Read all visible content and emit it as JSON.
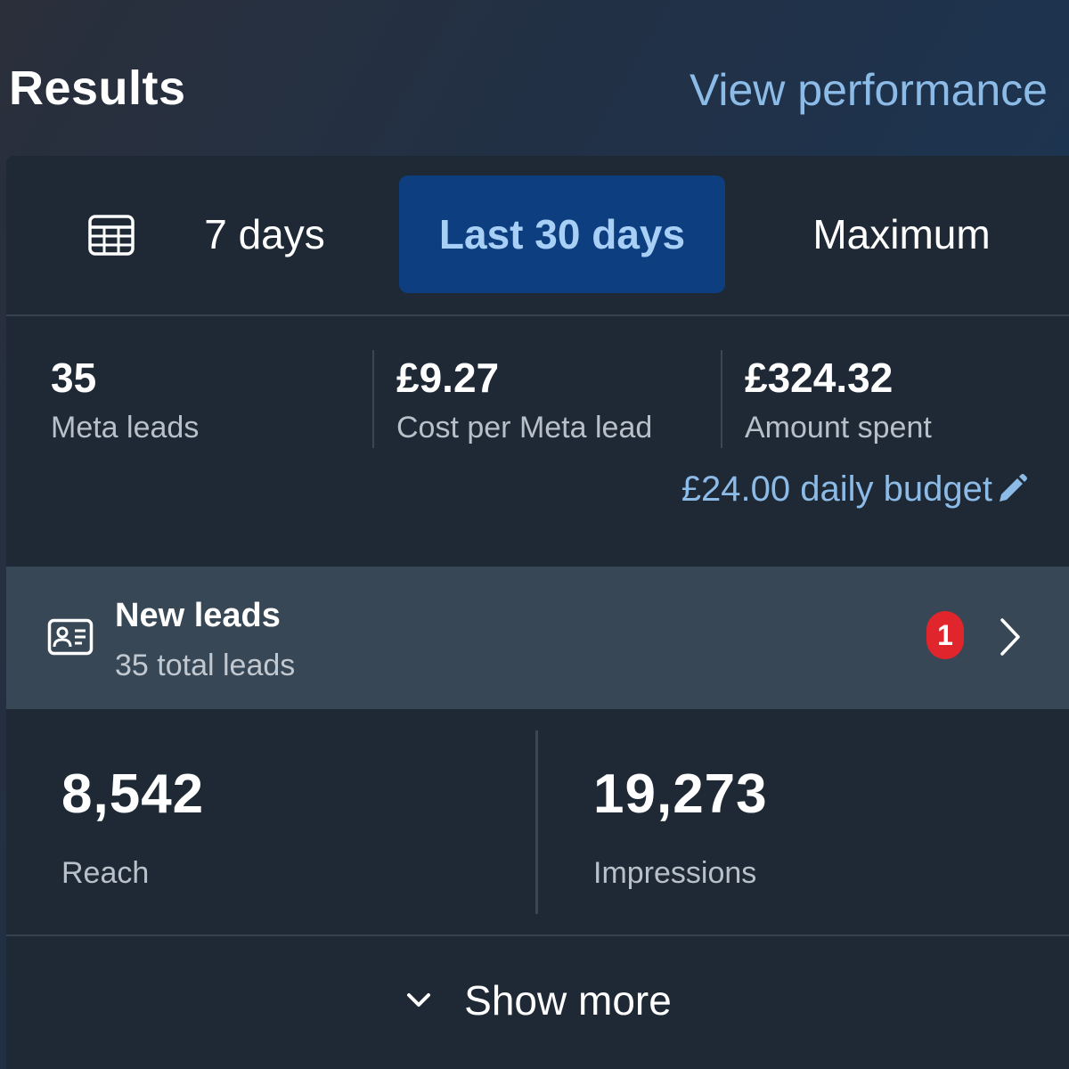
{
  "header": {
    "title": "Results",
    "view_performance": "View performance"
  },
  "tabs": {
    "calendar_icon": "calendar-grid-icon",
    "items": [
      {
        "label": "7 days",
        "selected": false
      },
      {
        "label": "Last 30 days",
        "selected": true
      },
      {
        "label": "Maximum",
        "selected": false
      }
    ]
  },
  "stats": [
    {
      "value": "35",
      "label": "Meta leads"
    },
    {
      "value": "£9.27",
      "label": "Cost per Meta lead"
    },
    {
      "value": "£324.32",
      "label": "Amount spent"
    }
  ],
  "budget": {
    "text": "£24.00 daily budget",
    "icon": "pencil-icon"
  },
  "leads": {
    "icon": "contact-card-icon",
    "title": "New leads",
    "subtitle": "35 total leads",
    "badge": "1",
    "chevron": "chevron-right-icon"
  },
  "metrics": [
    {
      "value": "8,542",
      "label": "Reach"
    },
    {
      "value": "19,273",
      "label": "Impressions"
    }
  ],
  "show_more": {
    "label": "Show more",
    "icon": "chevron-down-icon"
  },
  "colors": {
    "accent_link": "#8cbbe8",
    "selected_tab_bg": "#0c3e80",
    "badge_red": "#e0262c",
    "card_bg": "#1e2935",
    "leads_row_bg": "#374756"
  }
}
